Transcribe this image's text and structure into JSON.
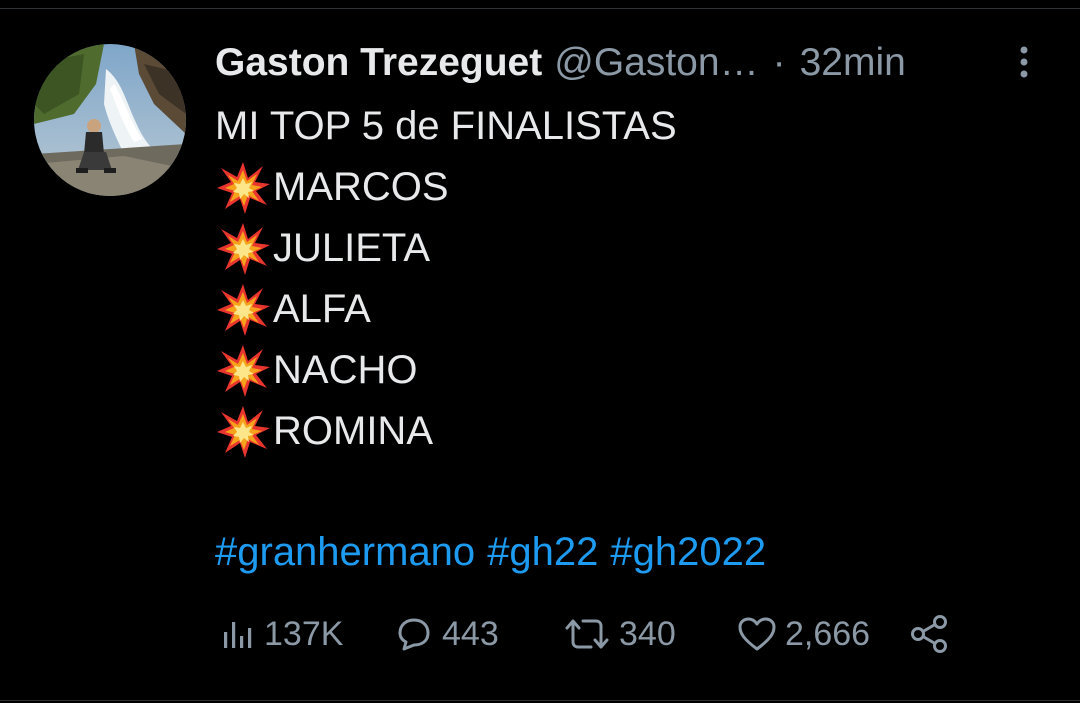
{
  "tweet": {
    "author": {
      "display_name": "Gaston Trezeguet",
      "handle": "@Gaston…",
      "avatar": "avatar-photo-waterfall"
    },
    "separator": "·",
    "time": "32min",
    "lines": [
      {
        "text": "MI TOP 5 de FINALISTAS",
        "emoji": null
      },
      {
        "text": "MARCOS",
        "emoji": "collision-emoji"
      },
      {
        "text": "JULIETA",
        "emoji": "collision-emoji"
      },
      {
        "text": "ALFA",
        "emoji": "collision-emoji"
      },
      {
        "text": "NACHO",
        "emoji": "collision-emoji"
      },
      {
        "text": "ROMINA",
        "emoji": "collision-emoji"
      }
    ],
    "hashtags": [
      "#granhermano",
      "#gh22",
      "#gh2022"
    ],
    "stats": {
      "views": "137K",
      "replies": "443",
      "retweets": "340",
      "likes": "2,666"
    }
  },
  "icons": {
    "more": "more-vertical-icon",
    "views": "views-chart-icon",
    "reply": "reply-bubble-icon",
    "retweet": "retweet-icon",
    "like": "heart-icon",
    "share": "share-icon"
  },
  "colors": {
    "background": "#000000",
    "text": "#e7e9ea",
    "secondary_text": "#8b98a5",
    "link": "#1d9bf0"
  }
}
